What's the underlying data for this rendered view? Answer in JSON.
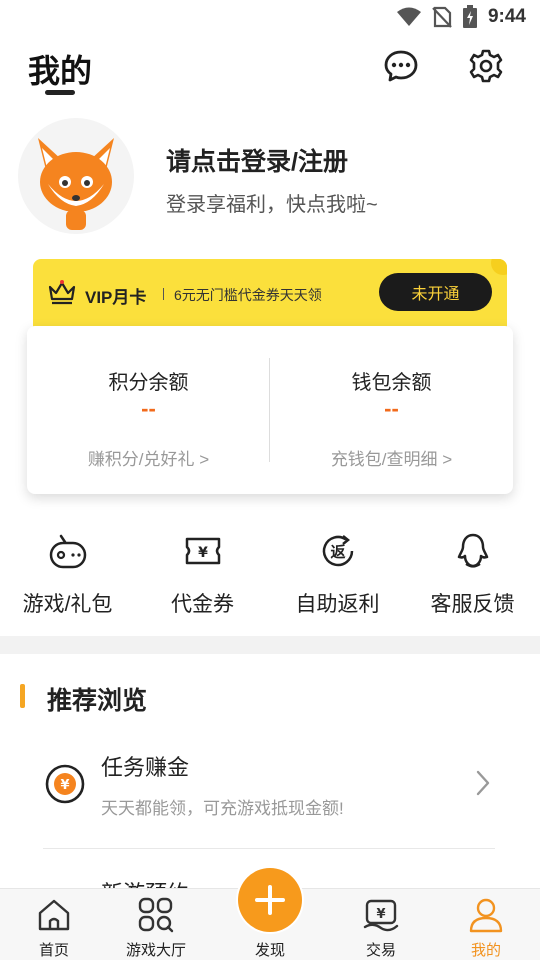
{
  "status_bar": {
    "time": "9:44"
  },
  "header": {
    "title": "我的"
  },
  "profile": {
    "login_text": "请点击登录/注册",
    "subtitle": "登录享福利，快点我啦~"
  },
  "vip": {
    "title": "VIP月卡",
    "desc": "6元无门槛代金券天天领",
    "button": "未开通"
  },
  "balance": {
    "points": {
      "label": "积分余额",
      "value": "--",
      "link": "赚积分/兑好礼 >"
    },
    "wallet": {
      "label": "钱包余额",
      "value": "--",
      "link": "充钱包/查明细 >"
    }
  },
  "shortcuts": [
    {
      "label": "游戏/礼包",
      "icon": "gamepad-icon"
    },
    {
      "label": "代金券",
      "icon": "voucher-icon"
    },
    {
      "label": "自助返利",
      "icon": "rebate-icon",
      "glyph": "返"
    },
    {
      "label": "客服反馈",
      "icon": "customer-service-icon"
    }
  ],
  "recommend": {
    "title": "推荐浏览",
    "items": [
      {
        "title": "任务赚金",
        "desc": "天天都能领，可充游戏抵现金额!",
        "icon": "coin-icon",
        "glyph": "¥"
      },
      {
        "title": "新游预约"
      }
    ]
  },
  "tabbar": [
    {
      "label": "首页",
      "icon": "home-icon"
    },
    {
      "label": "游戏大厅",
      "icon": "game-hall-icon"
    },
    {
      "label": "发现",
      "icon": "plus-icon"
    },
    {
      "label": "交易",
      "icon": "trade-icon"
    },
    {
      "label": "我的",
      "icon": "user-icon",
      "active": true
    }
  ],
  "colors": {
    "accent": "#f79a1c",
    "vip_bg": "#fbe03c",
    "value": "#f26a1b",
    "active_tab": "#f29320"
  }
}
